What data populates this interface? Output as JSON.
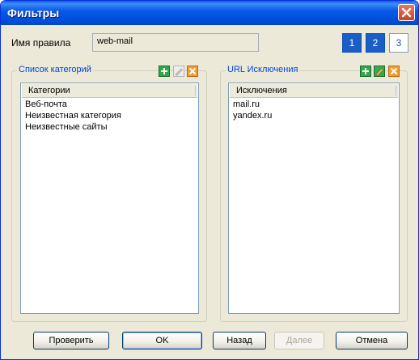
{
  "window": {
    "title": "Фильтры"
  },
  "rule": {
    "label": "Имя правила",
    "value": "web-mail"
  },
  "steps": [
    "1",
    "2",
    "3"
  ],
  "categories": {
    "group_title": "Список категорий",
    "column_header": "Категории",
    "items": [
      "Веб-почта",
      "Неизвестная категория",
      "Неизвестные сайты"
    ]
  },
  "exceptions": {
    "group_title": "URL Исключения",
    "column_header": "Исключения",
    "items": [
      "mail.ru",
      "yandex.ru"
    ]
  },
  "buttons": {
    "check": "Проверить",
    "ok": "OK",
    "back": "Назад",
    "next": "Далее",
    "cancel": "Отмена"
  },
  "icons": [
    "add-icon",
    "edit-icon",
    "delete-icon",
    "close-icon"
  ],
  "colors": {
    "title_bar": "#0a5ae8",
    "group_title": "#0046d5",
    "active_step": "#1a5fc8",
    "dialog_bg": "#ece9d8"
  }
}
